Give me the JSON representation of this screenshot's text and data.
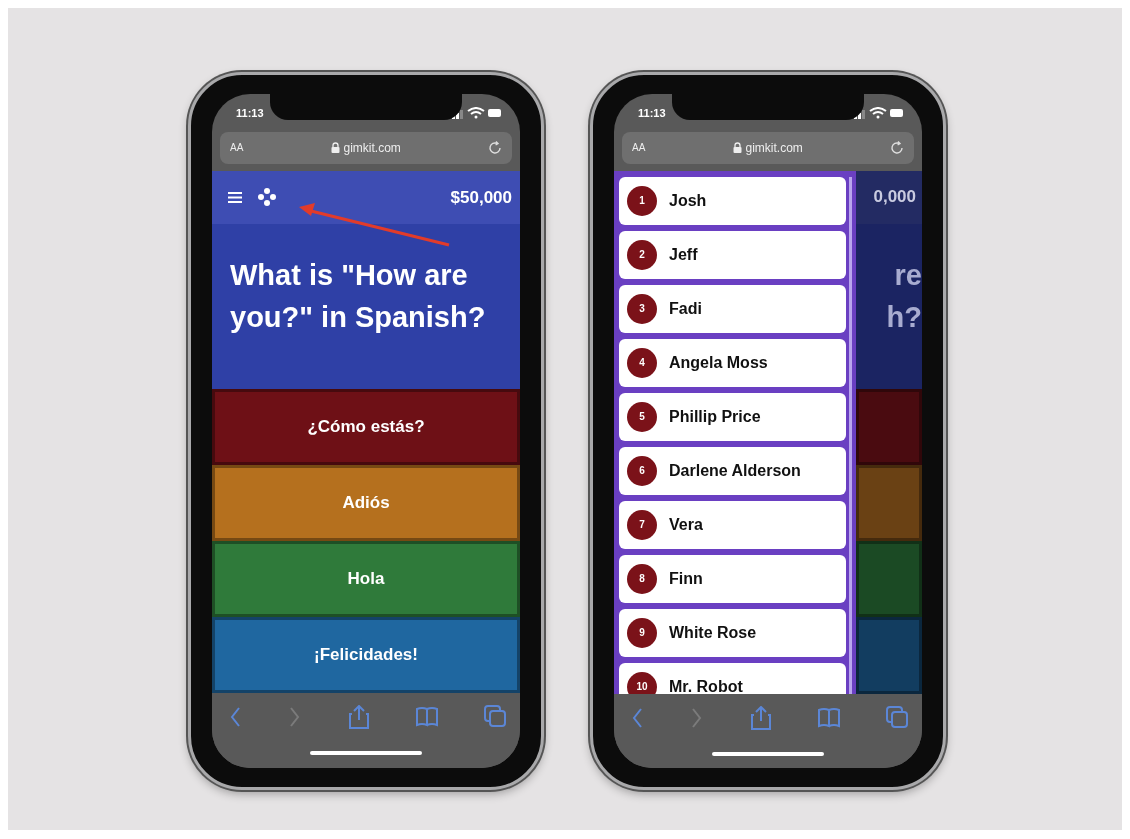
{
  "phones": [
    {
      "kind": "game",
      "status_bar": {
        "time": "11:13"
      },
      "address_bar": {
        "text_size": "AA",
        "url": "gimkit.com"
      },
      "header": {
        "balance": "$50,000"
      },
      "question": "What is \"How are you?\" in Spanish?",
      "answers": [
        {
          "text": "¿Cómo estás?",
          "color": "#6e1016"
        },
        {
          "text": "Adiós",
          "color": "#b5701e"
        },
        {
          "text": "Hola",
          "color": "#2f7a3a"
        },
        {
          "text": "¡Felicidades!",
          "color": "#1f67a0"
        }
      ],
      "toolbar": [
        {
          "kind": "back",
          "disabled": false
        },
        {
          "kind": "forward",
          "disabled": true
        },
        {
          "kind": "share",
          "disabled": false
        },
        {
          "kind": "bookmarks",
          "disabled": false
        },
        {
          "kind": "tabs",
          "disabled": false
        }
      ]
    },
    {
      "kind": "leaderboard",
      "status_bar": {
        "time": "11:13"
      },
      "address_bar": {
        "text_size": "AA",
        "url": "gimkit.com"
      },
      "players": [
        {
          "rank": "1",
          "name": "Josh"
        },
        {
          "rank": "2",
          "name": "Jeff"
        },
        {
          "rank": "3",
          "name": "Fadi"
        },
        {
          "rank": "4",
          "name": "Angela Moss"
        },
        {
          "rank": "5",
          "name": "Phillip Price"
        },
        {
          "rank": "6",
          "name": "Darlene Alderson"
        },
        {
          "rank": "7",
          "name": "Vera"
        },
        {
          "rank": "8",
          "name": "Finn"
        },
        {
          "rank": "9",
          "name": "White Rose"
        },
        {
          "rank": "10",
          "name": "Mr. Robot"
        }
      ],
      "background": {
        "balance": "0,000",
        "question_lines": [
          "re",
          "h?"
        ],
        "answers": [
          {
            "color": "#4a0b10"
          },
          {
            "color": "#6a4114"
          },
          {
            "color": "#1b4a24"
          },
          {
            "color": "#123d60"
          }
        ]
      },
      "toolbar": [
        {
          "kind": "back",
          "disabled": false
        },
        {
          "kind": "forward",
          "disabled": true
        },
        {
          "kind": "share",
          "disabled": false
        },
        {
          "kind": "bookmarks",
          "disabled": false
        },
        {
          "kind": "tabs",
          "disabled": false
        }
      ]
    }
  ]
}
